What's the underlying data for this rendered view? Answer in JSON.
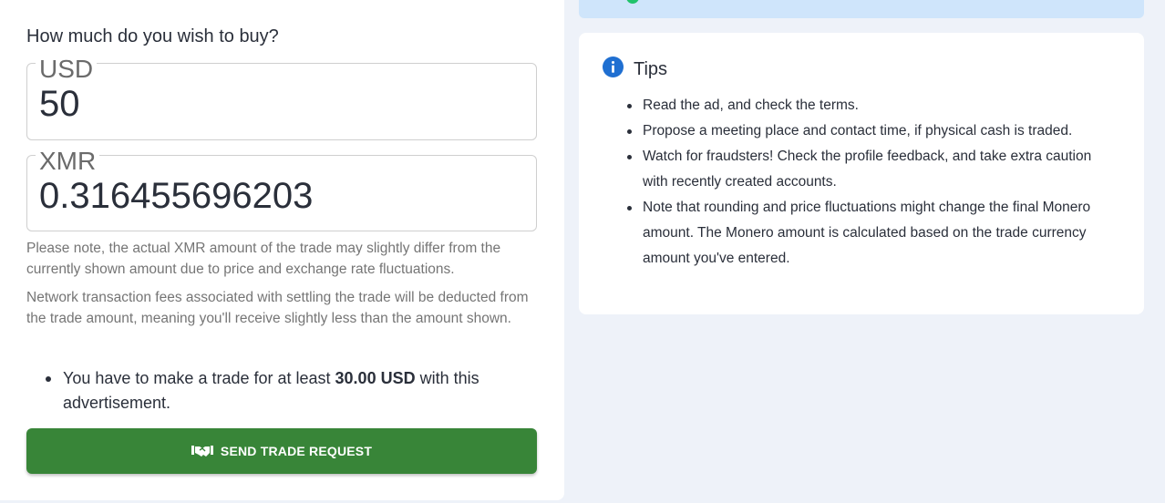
{
  "form": {
    "question": "How much do you wish to buy?",
    "fiat": {
      "currency": "USD",
      "amount": "50"
    },
    "crypto": {
      "currency": "XMR",
      "amount": "0.316455696203"
    },
    "note_fluctuation": "Please note, the actual XMR amount of the trade may slightly differ from the currently shown amount due to price and exchange rate fluctuations.",
    "note_fees": "Network transaction fees associated with settling the trade will be deducted from the trade amount, meaning you'll receive slightly less than the amount shown.",
    "minimum": {
      "prefix": "You have to make a trade for at least ",
      "amount": "30.00 USD",
      "suffix": " with this advertisement."
    },
    "submit_label": "SEND TRADE REQUEST",
    "submit_icon": "handshake-icon",
    "button_color": "#388538"
  },
  "tips": {
    "title": "Tips",
    "icon": "info-icon",
    "items": [
      "Read the ad, and check the terms.",
      "Propose a meeting place and contact time, if physical cash is traded.",
      "Watch for fraudsters! Check the profile feedback, and take extra caution with recently created accounts.",
      "Note that rounding and price fluctuations might change the final Monero amount. The Monero amount is calculated based on the trade currency amount you've entered."
    ]
  },
  "colors": {
    "accent_blue": "#1f6fd1",
    "banner_bg": "#cfe5fb",
    "status_green": "#21c36b"
  }
}
